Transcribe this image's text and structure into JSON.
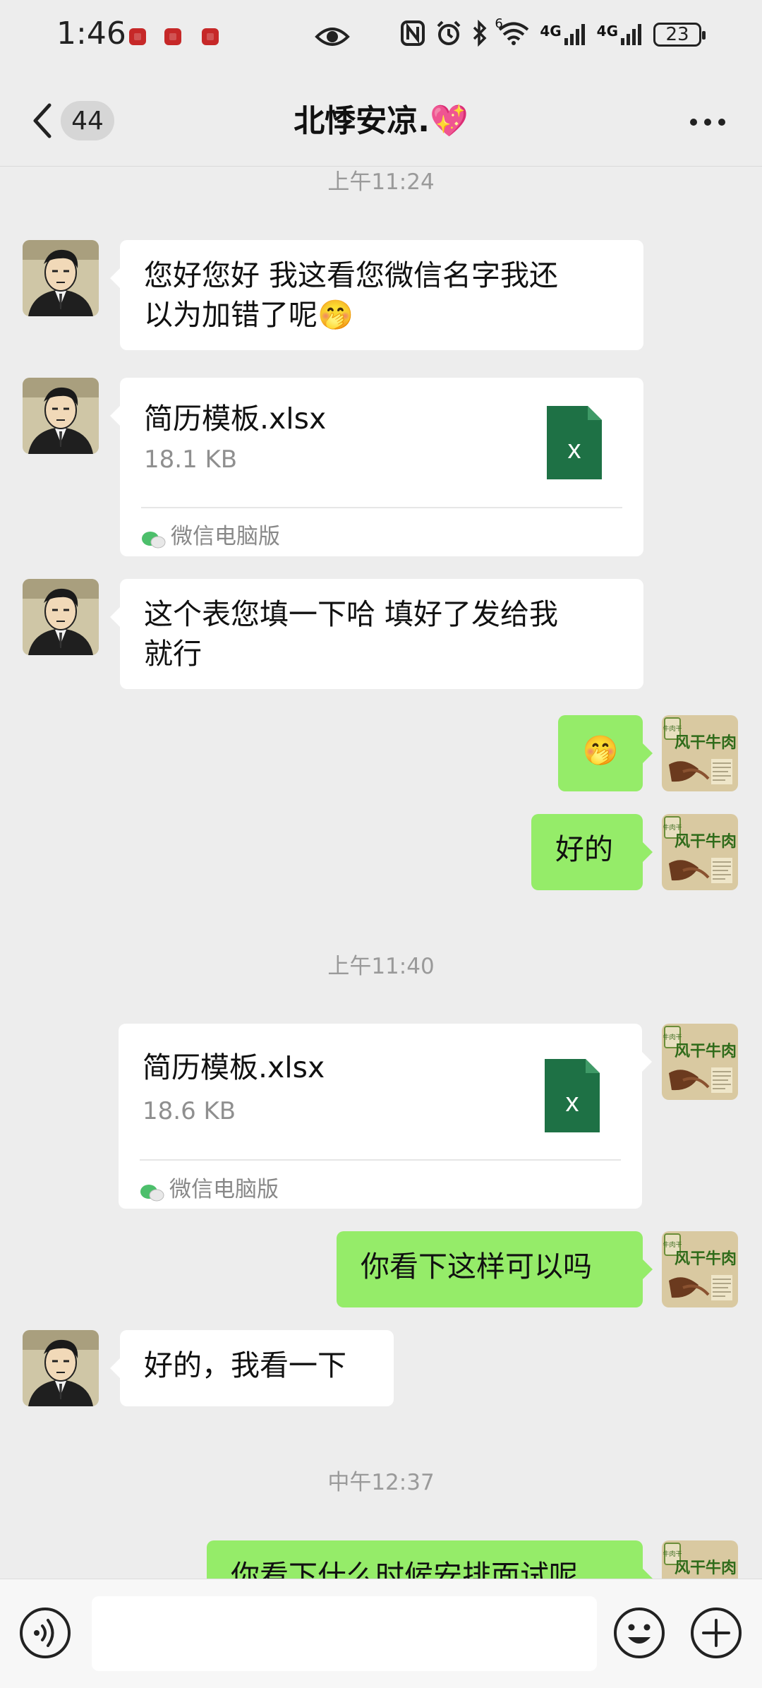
{
  "status_bar": {
    "time": "1:46",
    "signal_a": "6",
    "network_1": "4G",
    "network_2": "4G",
    "battery": "23"
  },
  "header": {
    "unread_count": "44",
    "chat_title": "北悸安凉.💖"
  },
  "timestamps": [
    "上午11:24",
    "上午11:40",
    "中午12:37"
  ],
  "messages": [
    {
      "sender": "them",
      "type": "text",
      "text_line1": "您好您好  我这看您微信名字我还",
      "text_line2": "以为加错了呢🤭"
    },
    {
      "sender": "them",
      "type": "file",
      "file_name": "简历模板.xlsx",
      "file_size": "18.1 KB",
      "file_icon_letter": "x",
      "source": "微信电脑版"
    },
    {
      "sender": "them",
      "type": "text",
      "text_line1": "这个表您填一下哈  填好了发给我",
      "text_line2": "就行"
    },
    {
      "sender": "me",
      "type": "text",
      "text": "🤭"
    },
    {
      "sender": "me",
      "type": "text",
      "text": "好的"
    },
    {
      "sender": "me",
      "type": "file",
      "file_name": "简历模板.xlsx",
      "file_size": "18.6 KB",
      "file_icon_letter": "x",
      "source": "微信电脑版"
    },
    {
      "sender": "me",
      "type": "text",
      "text": "你看下这样可以吗"
    },
    {
      "sender": "them",
      "type": "text",
      "text": "好的，我看一下"
    },
    {
      "sender": "me",
      "type": "text",
      "text": "你看下什么时候安排面试呢"
    }
  ],
  "my_avatar_text": {
    "top": "牛肉干",
    "main": "风干牛肉"
  },
  "input_bar": {
    "placeholder": ""
  },
  "colors": {
    "background": "#ededed",
    "my_bubble": "#95ec69",
    "their_bubble": "#ffffff",
    "excel_green": "#1e7145"
  }
}
